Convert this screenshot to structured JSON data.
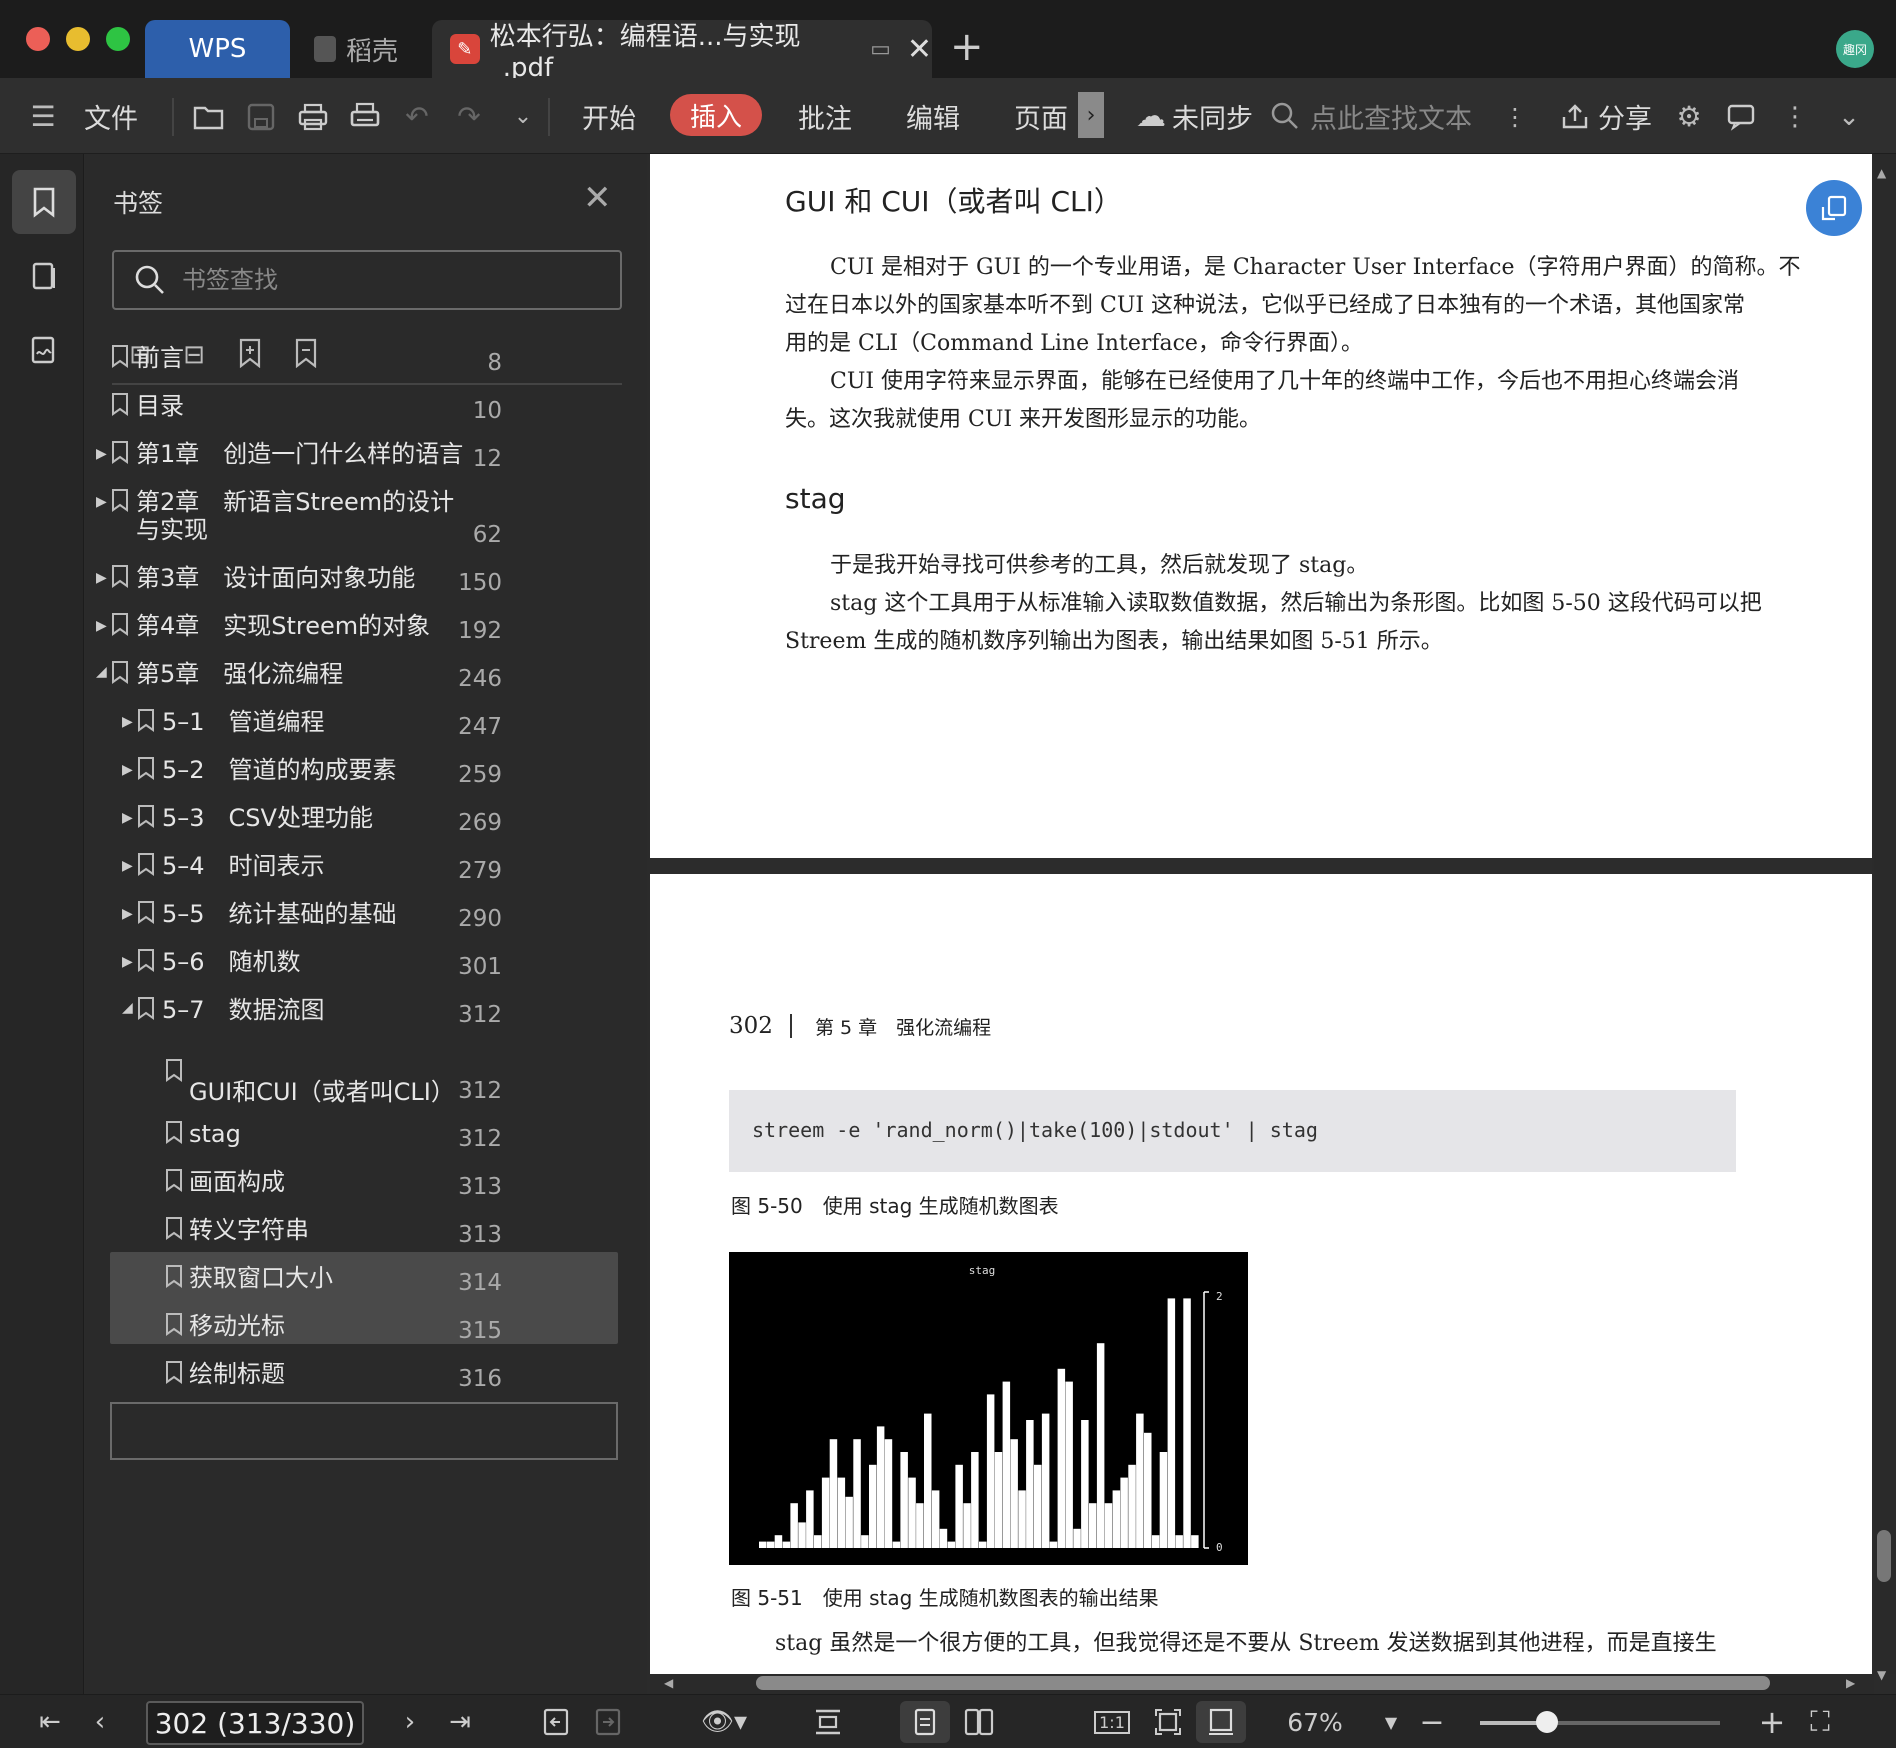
{
  "titlebar": {
    "tabs": [
      {
        "label": "WPS"
      },
      {
        "label": "稻壳"
      },
      {
        "label": "松本行弘：编程语...与实现_.pdf"
      }
    ],
    "avatar_text": "趣冈"
  },
  "toolbar": {
    "file_label": "文件",
    "menus": [
      "开始",
      "插入",
      "批注",
      "编辑",
      "页面"
    ],
    "sync_label": "未同步",
    "search_placeholder": "点此查找文本",
    "share_label": "分享"
  },
  "panel": {
    "title": "书签",
    "search_placeholder": "书签查找",
    "bookmarks": [
      {
        "label": "前言",
        "page": "8",
        "level": 0,
        "arrow": ""
      },
      {
        "label": "目录",
        "page": "10",
        "level": 0,
        "arrow": ""
      },
      {
        "label": "第1章　创造一门什么样的语言",
        "page": "12",
        "level": 0,
        "arrow": "▶"
      },
      {
        "label": "第2章　新语言Streem的设计",
        "label2": "与实现",
        "page": "62",
        "level": 0,
        "arrow": "▶"
      },
      {
        "label": "第3章　设计面向对象功能",
        "page": "150",
        "level": 0,
        "arrow": "▶"
      },
      {
        "label": "第4章　实现Streem的对象",
        "page": "192",
        "level": 0,
        "arrow": "▶"
      },
      {
        "label": "第5章　强化流编程",
        "page": "246",
        "level": 0,
        "arrow": "◢"
      },
      {
        "label": "5–1　管道编程",
        "page": "247",
        "level": 1,
        "arrow": "▶"
      },
      {
        "label": "5–2　管道的构成要素",
        "page": "259",
        "level": 1,
        "arrow": "▶"
      },
      {
        "label": "5–3　CSV处理功能",
        "page": "269",
        "level": 1,
        "arrow": "▶"
      },
      {
        "label": "5–4　时间表示",
        "page": "279",
        "level": 1,
        "arrow": "▶"
      },
      {
        "label": "5–5　统计基础的基础",
        "page": "290",
        "level": 1,
        "arrow": "▶"
      },
      {
        "label": "5–6　随机数",
        "page": "301",
        "level": 1,
        "arrow": "▶"
      },
      {
        "label": "5–7　数据流图",
        "page": "312",
        "level": 1,
        "arrow": "◢"
      },
      {
        "label": "GUI和CUI（或者叫CLI）",
        "page": "312",
        "level": 2,
        "arrow": ""
      },
      {
        "label": "stag",
        "page": "312",
        "level": 2,
        "arrow": ""
      },
      {
        "label": "画面构成",
        "page": "313",
        "level": 2,
        "arrow": ""
      },
      {
        "label": "转义字符串",
        "page": "313",
        "level": 2,
        "arrow": ""
      },
      {
        "label": "获取窗口大小",
        "page": "314",
        "level": 2,
        "arrow": ""
      },
      {
        "label": "移动光标",
        "page": "315",
        "level": 2,
        "arrow": ""
      },
      {
        "label": "绘制标题",
        "page": "316",
        "level": 2,
        "arrow": ""
      }
    ]
  },
  "document": {
    "h1": "GUI 和 CUI（或者叫 CLI）",
    "p1_l1": "CUI 是相对于 GUI 的一个专业用语，是 Character User Interface（字符用户界面）的简称。不",
    "p1_l2": "过在日本以外的国家基本听不到 CUI 这种说法，它似乎已经成了日本独有的一个术语，其他国家常",
    "p1_l3": "用的是 CLI（Command Line Interface，命令行界面）。",
    "p2_l1": "CUI 使用字符来显示界面，能够在已经使用了几十年的终端中工作，今后也不用担心终端会消",
    "p2_l2": "失。这次我就使用 CUI 来开发图形显示的功能。",
    "h2": "stag",
    "p3": "于是我开始寻找可供参考的工具，然后就发现了 stag。",
    "p4_l1": "stag 这个工具用于从标准输入读取数值数据，然后输出为条形图。比如图 5-50 这段代码可以把",
    "p4_l2": "Streem 生成的随机数序列输出为图表，输出结果如图 5-51 所示。",
    "page_num": "302",
    "running_head": "第 5 章　强化流编程",
    "code": "streem -e 'rand_norm()|take(100)|stdout' | stag",
    "fig50_caption": "图 5-50　使用 stag 生成随机数图表",
    "fig51_caption": "图 5-51　使用 stag 生成随机数图表的输出结果",
    "p5": "stag 虽然是一个很方便的工具，但我觉得还是不要从 Streem 发送数据到其他进程，而是直接生",
    "chart": {
      "title": "stag",
      "axis_max": "2",
      "axis_min": "0"
    }
  },
  "chart_data": {
    "type": "bar",
    "title": "stag",
    "ylim": [
      0,
      2
    ],
    "values": [
      0.05,
      0.05,
      0.1,
      0.05,
      0.35,
      0.2,
      0.45,
      0.1,
      0.55,
      0.85,
      0.55,
      0.4,
      0.85,
      0.1,
      0.65,
      0.95,
      0.85,
      0.05,
      0.75,
      0.55,
      0.35,
      1.05,
      0.45,
      0.15,
      0.05,
      0.65,
      0.35,
      0.75,
      0.05,
      1.2,
      0.75,
      1.3,
      0.85,
      0.45,
      1.0,
      0.65,
      1.05,
      0.05,
      1.4,
      1.3,
      0.15,
      1.0,
      0.35,
      1.6,
      0.35,
      0.45,
      0.55,
      0.65,
      1.05,
      0.9,
      0.1,
      0.75,
      1.95,
      0.1,
      1.95,
      0.1
    ]
  },
  "status": {
    "page_display": "302 (313/330)",
    "zoom": "67%",
    "zoom_fraction": 0.28
  }
}
